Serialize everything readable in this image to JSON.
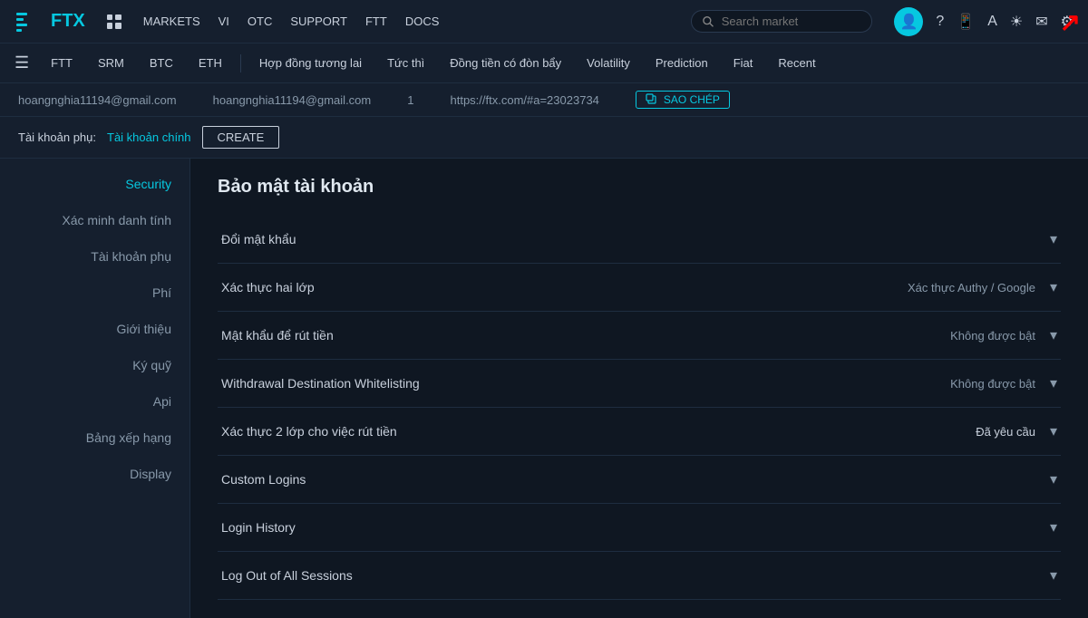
{
  "topNav": {
    "logo": "FTX",
    "links": [
      {
        "label": "MARKETS",
        "id": "markets"
      },
      {
        "label": "VI",
        "id": "vi"
      },
      {
        "label": "OTC",
        "id": "otc"
      },
      {
        "label": "SUPPORT",
        "id": "support"
      },
      {
        "label": "FTT",
        "id": "ftt"
      },
      {
        "label": "DOCS",
        "id": "docs"
      }
    ],
    "search": {
      "placeholder": "Search market"
    },
    "icons": [
      "user",
      "help",
      "mobile",
      "translate",
      "theme",
      "mail",
      "settings"
    ]
  },
  "secNav": {
    "items": [
      {
        "label": "FTT",
        "id": "ftt"
      },
      {
        "label": "SRM",
        "id": "srm"
      },
      {
        "label": "BTC",
        "id": "btc"
      },
      {
        "label": "ETH",
        "id": "eth"
      },
      {
        "label": "Hợp đồng tương lai",
        "id": "futures"
      },
      {
        "label": "Tức thì",
        "id": "instant"
      },
      {
        "label": "Đồng tiền có đòn bẩy",
        "id": "leveraged"
      },
      {
        "label": "Volatility",
        "id": "volatility"
      },
      {
        "label": "Prediction",
        "id": "prediction"
      },
      {
        "label": "Fiat",
        "id": "fiat"
      },
      {
        "label": "Recent",
        "id": "recent"
      }
    ]
  },
  "userBar": {
    "email1": "hoangnghia11194@gmail.com",
    "email2": "hoangnghia11194@gmail.com",
    "number": "1",
    "referralUrl": "https://ftx.com/#a=23023734",
    "copyBtn": "SAO CHÉP"
  },
  "subBar": {
    "label": "Tài khoản phụ:",
    "mainLink": "Tài khoản chính",
    "createBtn": "CREATE"
  },
  "sidebar": {
    "items": [
      {
        "label": "Security",
        "id": "security",
        "active": true
      },
      {
        "label": "Xác minh danh tính",
        "id": "verify"
      },
      {
        "label": "Tài khoản phụ",
        "id": "subaccount"
      },
      {
        "label": "Phí",
        "id": "fees"
      },
      {
        "label": "Giới thiệu",
        "id": "referral"
      },
      {
        "label": "Ký quỹ",
        "id": "margin"
      },
      {
        "label": "Api",
        "id": "api"
      },
      {
        "label": "Bảng xếp hạng",
        "id": "leaderboard"
      },
      {
        "label": "Display",
        "id": "display"
      }
    ]
  },
  "content": {
    "title": "Bảo mật tài khoản",
    "rows": [
      {
        "label": "Đổi mật khẩu",
        "value": "",
        "id": "change-password"
      },
      {
        "label": "Xác thực hai lớp",
        "value": "Xác thực Authy / Google",
        "id": "two-factor"
      },
      {
        "label": "Mật khẩu để rút tiền",
        "value": "Không được bật",
        "id": "withdrawal-password"
      },
      {
        "label": "Withdrawal Destination Whitelisting",
        "value": "Không được bật",
        "id": "whitelisting"
      },
      {
        "label": "Xác thực 2 lớp cho việc rút tiền",
        "value": "Đã yêu cầu",
        "id": "2fa-withdrawal"
      },
      {
        "label": "Custom Logins",
        "value": "",
        "id": "custom-logins"
      },
      {
        "label": "Login History",
        "value": "",
        "id": "login-history"
      },
      {
        "label": "Log Out of All Sessions",
        "value": "",
        "id": "logout-all"
      }
    ]
  }
}
